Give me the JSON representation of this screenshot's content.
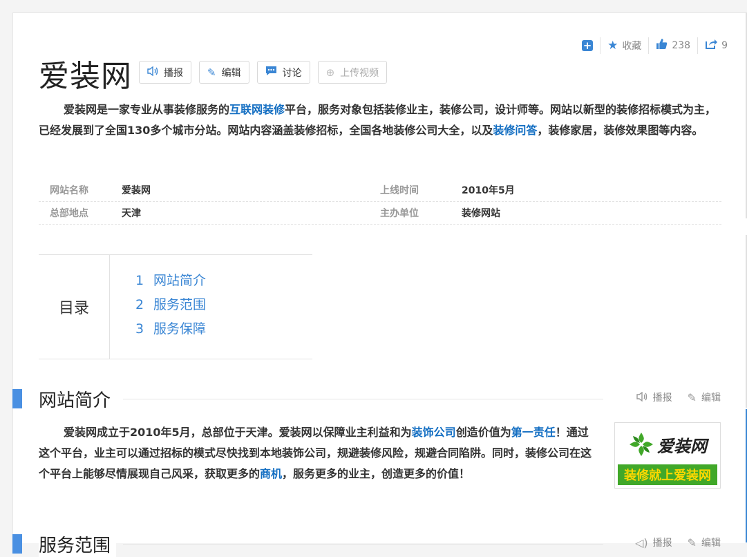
{
  "actions": {
    "favorite_label": "收藏",
    "like_count": "238",
    "share_count": "9"
  },
  "title": "爱装网",
  "title_buttons": {
    "report": "播报",
    "edit": "编辑",
    "discuss": "讨论",
    "upload_video": "上传视频"
  },
  "summary": {
    "p1": "爱装网是一家专业从事装修服务的",
    "link1": "互联网装修",
    "p2": "平台，服务对象包括装修业主，装修公司，设计师等。网站以新型的装修招标模式为主，已经发展到了全国130多个城市分站。网站内容涵盖装修招标，全国各地装修公司大全，以及",
    "link2": "装修问答",
    "p3": "，装修家居，装修效果图等内容。"
  },
  "info": {
    "name_label": "网站名称",
    "name_value": "爱装网",
    "online_label": "上线时间",
    "online_value": "2010年5月",
    "hq_label": "总部地点",
    "hq_value": "天津",
    "sponsor_label": "主办单位",
    "sponsor_value": "装修网站"
  },
  "catalog": {
    "title": "目录",
    "items": [
      {
        "num": "1",
        "label": "网站简介"
      },
      {
        "num": "2",
        "label": "服务范围"
      },
      {
        "num": "3",
        "label": "服务保障"
      }
    ]
  },
  "section1": {
    "title": "网站简介",
    "report": "播报",
    "edit": "编辑",
    "p1": "爱装网成立于2010年5月，总部位于天津。爱装网以保障业主利益和为",
    "link1": "装饰公司",
    "p2": "创造价值为",
    "link2": "第一责任",
    "p3": "！通过这个平台，业主可以通过招标的模式尽快找到本地装饰公司，规避装修风险，规避合同陷阱。同时，装修公司在这个平台上能够尽情展现自己风采，获取更多的",
    "link3": "商机",
    "p4": "，服务更多的业主，创造更多的价值！"
  },
  "logo": {
    "brand": "爱装网",
    "slogan": "装修就上爱装网"
  },
  "section2": {
    "title": "服务范围",
    "report": "播报",
    "edit": "编辑"
  },
  "colors": {
    "accent": "#3a86d4",
    "link": "#136ec2",
    "section_bar": "#4a90e2",
    "logo_green": "#41a829",
    "logo_yellow": "#ffd800"
  }
}
